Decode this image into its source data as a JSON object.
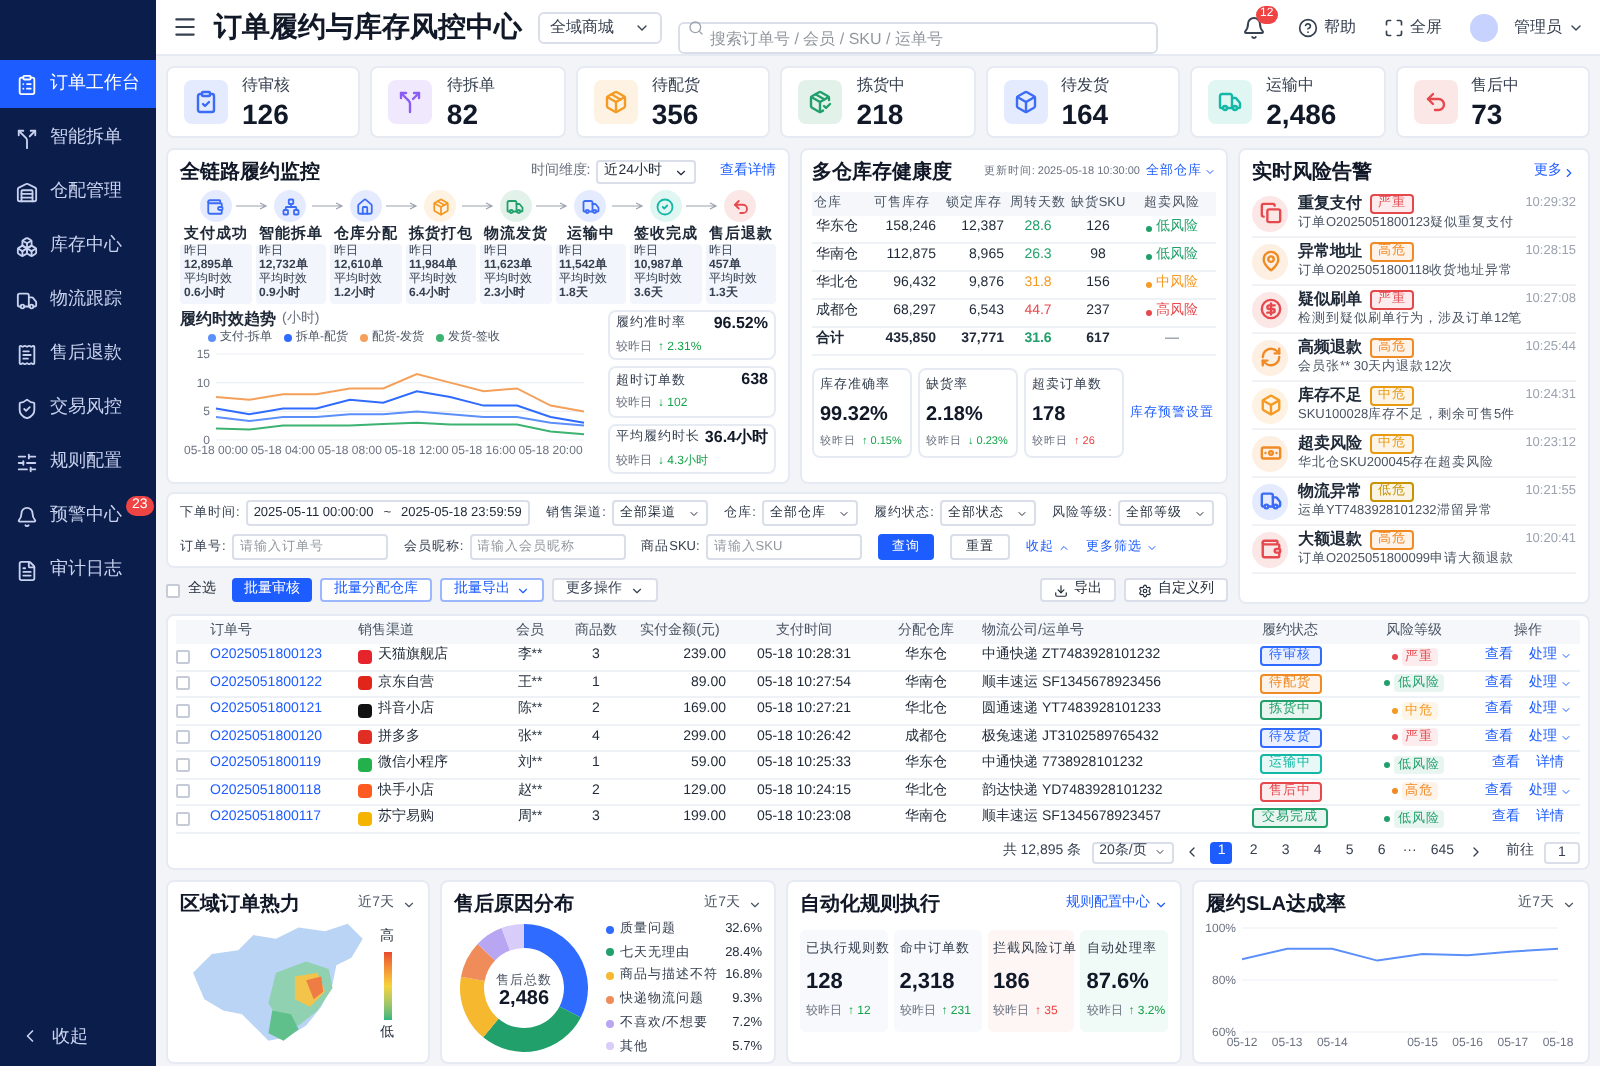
{
  "sidebar": {
    "items": [
      {
        "label": "订单工作台",
        "selected": true
      },
      {
        "label": "智能拆单",
        "selected": false
      },
      {
        "label": "仓配管理",
        "selected": false
      },
      {
        "label": "库存中心",
        "selected": false
      },
      {
        "label": "物流跟踪",
        "selected": false
      },
      {
        "label": "售后退款",
        "selected": false
      },
      {
        "label": "交易风控",
        "selected": false
      },
      {
        "label": "规则配置",
        "selected": false
      },
      {
        "label": "预警中心",
        "selected": false,
        "badge": "23"
      },
      {
        "label": "审计日志",
        "selected": false
      }
    ],
    "collapse": "收起"
  },
  "header": {
    "title": "订单履约与库存风控中心",
    "store": "全域商城",
    "search_placeholder": "搜索订单号 / 会员 / SKU / 运单号",
    "notifications": "12",
    "help": "帮助",
    "fullscreen": "全屏",
    "user": "管理员"
  },
  "kpis": [
    {
      "label": "待审核",
      "value": "126",
      "color": "#3b6cf6"
    },
    {
      "label": "待拆单",
      "value": "82",
      "color": "#8b5cf6"
    },
    {
      "label": "待配货",
      "value": "356",
      "color": "#f59a23"
    },
    {
      "label": "拣货中",
      "value": "218",
      "color": "#22a06b"
    },
    {
      "label": "待发货",
      "value": "164",
      "color": "#3b6cf6"
    },
    {
      "label": "运输中",
      "value": "2,486",
      "color": "#14b8a6"
    },
    {
      "label": "售后中",
      "value": "73",
      "color": "#e5484d"
    }
  ],
  "pipeline": {
    "title": "全链路履约监控",
    "range_label": "时间维度:",
    "range": "近24小时",
    "link": "查看详情",
    "stages": [
      {
        "name": "支付成功",
        "color": "#3b6cf6",
        "yesterday_label": "昨日",
        "yesterday": "12,895单",
        "avg_label": "平均时效",
        "avg": "0.6小时"
      },
      {
        "name": "智能拆单",
        "color": "#3b6cf6",
        "yesterday_label": "昨日",
        "yesterday": "12,732单",
        "avg_label": "平均时效",
        "avg": "0.9小时"
      },
      {
        "name": "仓库分配",
        "color": "#3b6cf6",
        "yesterday_label": "昨日",
        "yesterday": "12,610单",
        "avg_label": "平均时效",
        "avg": "1.2小时"
      },
      {
        "name": "拣货打包",
        "color": "#f59a23",
        "yesterday_label": "昨日",
        "yesterday": "11,984单",
        "avg_label": "平均时效",
        "avg": "6.4小时"
      },
      {
        "name": "物流发货",
        "color": "#22a06b",
        "yesterday_label": "昨日",
        "yesterday": "11,623单",
        "avg_label": "平均时效",
        "avg": "2.3小时"
      },
      {
        "name": "运输中",
        "color": "#3b6cf6",
        "yesterday_label": "昨日",
        "yesterday": "11,542单",
        "avg_label": "平均时效",
        "avg": "1.8天"
      },
      {
        "name": "签收完成",
        "color": "#14b8a6",
        "yesterday_label": "昨日",
        "yesterday": "10,987单",
        "avg_label": "平均时效",
        "avg": "3.6天"
      },
      {
        "name": "售后退款",
        "color": "#e5484d",
        "yesterday_label": "昨日",
        "yesterday": "457单",
        "avg_label": "平均时效",
        "avg": "1.3天"
      }
    ],
    "chart_data": {
      "type": "line",
      "title": "履约时效趋势",
      "ylabel": "(小时)",
      "categories": [
        "05-18 00:00",
        null,
        "05-18 04:00",
        null,
        "05-18 08:00",
        null,
        "05-18 12:00",
        null,
        "05-18 16:00",
        null,
        "05-18 20:00",
        null
      ],
      "ylim": [
        0,
        15
      ],
      "yticks": [
        {
          "value": 0,
          "label": "0"
        },
        {
          "value": 5,
          "label": "5"
        },
        {
          "value": 10,
          "label": "10"
        },
        {
          "value": 15,
          "label": "15"
        }
      ],
      "series": [
        {
          "name": "支付-拆单",
          "color": "#5b8ff9",
          "values": [
            4,
            3.3,
            4,
            4,
            4.5,
            4.5,
            5,
            4.5,
            4,
            4,
            3,
            2.5
          ]
        },
        {
          "name": "拆单-配货",
          "color": "#2f6bff",
          "values": [
            5.5,
            4.5,
            5.5,
            5.5,
            7,
            6.5,
            8.5,
            7.5,
            6,
            6,
            4,
            3
          ]
        },
        {
          "name": "配货-发货",
          "color": "#f5a05a",
          "values": [
            7.5,
            7,
            8,
            8,
            9,
            9,
            11.5,
            10,
            8.5,
            9,
            6,
            5
          ]
        },
        {
          "name": "发货-签收",
          "color": "#3cb371",
          "values": [
            2,
            1.8,
            2.5,
            2.5,
            2.5,
            2.8,
            3,
            2.7,
            2.7,
            2.7,
            1.5,
            1
          ]
        }
      ]
    },
    "stats": [
      {
        "label": "履约准时率",
        "value": "96.52%",
        "compare": "较昨日",
        "change": "↑ 2.31%",
        "good": true
      },
      {
        "label": "超时订单数",
        "value": "638",
        "compare": "较昨日",
        "change": "↓ 102",
        "good": true
      },
      {
        "label": "平均履约时长",
        "value": "36.4小时",
        "compare": "较昨日",
        "change": "↓ 4.3小时",
        "good": true
      }
    ]
  },
  "inventory": {
    "title": "多仓库存健康度",
    "updated": "更新时间: 2025-05-18 10:30:00",
    "scope": "全部仓库",
    "columns": [
      "仓库",
      "可售库存",
      "锁定库存",
      "周转天数",
      "缺货SKU",
      "超卖风险"
    ],
    "rows": [
      {
        "warehouse": "华东仓",
        "sellable": "158,246",
        "locked": "12,387",
        "turnover": {
          "text": "28.6",
          "color": "#22a06b"
        },
        "short": "126",
        "risk": {
          "text": "低风险",
          "color": "#22a06b"
        }
      },
      {
        "warehouse": "华南仓",
        "sellable": "112,875",
        "locked": "8,965",
        "turnover": {
          "text": "26.3",
          "color": "#22a06b"
        },
        "short": "98",
        "risk": {
          "text": "低风险",
          "color": "#22a06b"
        }
      },
      {
        "warehouse": "华北仓",
        "sellable": "96,432",
        "locked": "9,876",
        "turnover": {
          "text": "31.8",
          "color": "#f59a23"
        },
        "short": "156",
        "risk": {
          "text": "中风险",
          "color": "#f59a23"
        }
      },
      {
        "warehouse": "成都仓",
        "sellable": "68,297",
        "locked": "6,543",
        "turnover": {
          "text": "44.7",
          "color": "#e5484d"
        },
        "short": "237",
        "risk": {
          "text": "高风险",
          "color": "#e5484d"
        }
      }
    ],
    "total": {
      "warehouse": "合计",
      "sellable": "435,850",
      "locked": "37,771",
      "turnover": {
        "text": "31.6",
        "color": "#22a06b"
      },
      "short": "617",
      "risk": {
        "text": "—"
      }
    },
    "stats": [
      {
        "label": "库存准确率",
        "value": "99.32%",
        "compare": "较昨日",
        "change": "↑ 0.15%",
        "good": true
      },
      {
        "label": "缺货率",
        "value": "2.18%",
        "compare": "较昨日",
        "change": "↓ 0.23%",
        "good": true
      },
      {
        "label": "超卖订单数",
        "value": "178",
        "compare": "较昨日",
        "change": "↑ 26",
        "good": false
      }
    ],
    "link": "库存预警设置"
  },
  "alerts": {
    "title": "实时风险告警",
    "more": "更多",
    "items": [
      {
        "title": "重复支付",
        "tag": {
          "text": "严重",
          "color": "#e5484d"
        },
        "text": "订单O2025051800123疑似重复支付",
        "time": "10:29:32",
        "color": "#e5484d"
      },
      {
        "title": "异常地址",
        "tag": {
          "text": "高危",
          "color": "#f08a24"
        },
        "text": "订单O2025051800118收货地址异常",
        "time": "10:28:15",
        "color": "#f08a24"
      },
      {
        "title": "疑似刷单",
        "tag": {
          "text": "严重",
          "color": "#e5484d"
        },
        "text": "检测到疑似刷单行为，涉及订单12笔",
        "time": "10:27:08",
        "color": "#e5484d"
      },
      {
        "title": "高频退款",
        "tag": {
          "text": "高危",
          "color": "#f08a24"
        },
        "text": "会员张** 30天内退款12次",
        "time": "10:25:44",
        "color": "#f08a24"
      },
      {
        "title": "库存不足",
        "tag": {
          "text": "中危",
          "color": "#e89a10"
        },
        "text": "SKU100028库存不足，剩余可售5件",
        "time": "10:24:31",
        "color": "#f59a23"
      },
      {
        "title": "超卖风险",
        "tag": {
          "text": "中危",
          "color": "#e89a10"
        },
        "text": "华北仓SKU200045存在超卖风险",
        "time": "10:23:12",
        "color": "#f08a24"
      },
      {
        "title": "物流异常",
        "tag": {
          "text": "低危",
          "color": "#c99400"
        },
        "text": "运单YT7483928101232滞留异常",
        "time": "10:21:55",
        "color": "#3b6cf6"
      },
      {
        "title": "大额退款",
        "tag": {
          "text": "高危",
          "color": "#f08a24"
        },
        "text": "订单O2025051800099申请大额退款",
        "time": "10:20:41",
        "color": "#e5484d"
      }
    ]
  },
  "filters": [
    {
      "kind": "daterange",
      "label": "下单时间:",
      "start": "2025-05-11 00:00:00",
      "separator": "~",
      "end": "2025-05-18 23:59:59"
    },
    {
      "kind": "select",
      "label": "销售渠道:",
      "value": "全部渠道"
    },
    {
      "kind": "select",
      "label": "仓库:",
      "value": "全部仓库"
    },
    {
      "kind": "select",
      "label": "履约状态:",
      "value": "全部状态"
    },
    {
      "kind": "select",
      "label": "风险等级:",
      "value": "全部等级"
    },
    {
      "kind": "input",
      "label": "订单号:",
      "placeholder": "请输入订单号"
    },
    {
      "kind": "input",
      "label": "会员昵称:",
      "placeholder": "请输入会员昵称"
    },
    {
      "kind": "input",
      "label": "商品SKU:",
      "placeholder": "请输入SKU"
    }
  ],
  "filter_buttons": [
    {
      "label": "查询",
      "kind": "primary"
    },
    {
      "label": "重置",
      "kind": "default"
    },
    {
      "label": "收起",
      "kind": "collapse"
    },
    {
      "label": "更多筛选",
      "kind": "expand"
    }
  ],
  "bulk": {
    "select_all": {
      "label": "全选",
      "checked": false
    },
    "buttons": [
      {
        "label": "批量审核",
        "kind": "primary"
      },
      {
        "label": "批量分配仓库",
        "kind": "outline"
      },
      {
        "label": "批量导出",
        "kind": "outline-menu"
      },
      {
        "label": "更多操作",
        "kind": "menu"
      }
    ],
    "tools": [
      {
        "label": "导出",
        "kind": "download"
      },
      {
        "label": "自定义列",
        "kind": "settings"
      }
    ]
  },
  "orders": {
    "columns": [
      "订单号",
      "销售渠道",
      "会员",
      "商品数",
      "实付金额(元)",
      "支付时间",
      "分配仓库",
      "物流公司/运单号",
      "履约状态",
      "风险等级",
      "操作"
    ],
    "rows": [
      {
        "checked": false,
        "id": "O2025051800123",
        "channel": {
          "text": "天猫旗舰店",
          "color": "#e5242b"
        },
        "member": "李**",
        "qty": "3",
        "amount": "239.00",
        "paid": "05-18 10:28:31",
        "warehouse": "华东仓",
        "carrier": "中通快递",
        "waybill": "ZT7483928101232",
        "status": {
          "text": "待审核",
          "color": "#2f6bff"
        },
        "risk": {
          "text": "严重",
          "color": "#e5484d"
        },
        "actions": [
          {
            "label": "查看",
            "menu": false
          },
          {
            "label": "处理",
            "menu": true
          }
        ]
      },
      {
        "checked": false,
        "id": "O2025051800122",
        "channel": {
          "text": "京东自营",
          "color": "#e1251b"
        },
        "member": "王**",
        "qty": "1",
        "amount": "89.00",
        "paid": "05-18 10:27:54",
        "warehouse": "华南仓",
        "carrier": "顺丰速运",
        "waybill": "SF1345678923456",
        "status": {
          "text": "待配货",
          "color": "#f08a24"
        },
        "risk": {
          "text": "低风险",
          "color": "#22a06b"
        },
        "actions": [
          {
            "label": "查看",
            "menu": false
          },
          {
            "label": "处理",
            "menu": true
          }
        ]
      },
      {
        "checked": false,
        "id": "O2025051800121",
        "channel": {
          "text": "抖音小店",
          "color": "#111111"
        },
        "member": "陈**",
        "qty": "2",
        "amount": "169.00",
        "paid": "05-18 10:27:21",
        "warehouse": "华北仓",
        "carrier": "圆通速递",
        "waybill": "YT7483928101233",
        "status": {
          "text": "拣货中",
          "color": "#22a06b"
        },
        "risk": {
          "text": "中危",
          "color": "#f59a23"
        },
        "actions": [
          {
            "label": "查看",
            "menu": false
          },
          {
            "label": "处理",
            "menu": true
          }
        ]
      },
      {
        "checked": false,
        "id": "O2025051800120",
        "channel": {
          "text": "拼多多",
          "color": "#e02e24"
        },
        "member": "张**",
        "qty": "4",
        "amount": "299.00",
        "paid": "05-18 10:26:42",
        "warehouse": "成都仓",
        "carrier": "极兔速递",
        "waybill": "JT3102589765432",
        "status": {
          "text": "待发货",
          "color": "#2f6bff"
        },
        "risk": {
          "text": "严重",
          "color": "#e5484d"
        },
        "actions": [
          {
            "label": "查看",
            "menu": false
          },
          {
            "label": "处理",
            "menu": true
          }
        ]
      },
      {
        "checked": false,
        "id": "O2025051800119",
        "channel": {
          "text": "微信小程序",
          "color": "#22b14c"
        },
        "member": "刘**",
        "qty": "1",
        "amount": "59.00",
        "paid": "05-18 10:25:33",
        "warehouse": "华东仓",
        "carrier": "中通快递",
        "waybill": "7738928101232",
        "status": {
          "text": "运输中",
          "color": "#14b8a6"
        },
        "risk": {
          "text": "低风险",
          "color": "#22a06b"
        },
        "actions": [
          {
            "label": "查看",
            "menu": false
          },
          {
            "label": "详情",
            "menu": false
          }
        ]
      },
      {
        "checked": false,
        "id": "O2025051800118",
        "channel": {
          "text": "快手小店",
          "color": "#ff5a1f"
        },
        "member": "赵**",
        "qty": "2",
        "amount": "129.00",
        "paid": "05-18 10:24:15",
        "warehouse": "华北仓",
        "carrier": "韵达快递",
        "waybill": "YD7483928101232",
        "status": {
          "text": "售后中",
          "color": "#e5484d"
        },
        "risk": {
          "text": "高危",
          "color": "#f08a24"
        },
        "actions": [
          {
            "label": "查看",
            "menu": false
          },
          {
            "label": "处理",
            "menu": true
          }
        ]
      },
      {
        "checked": false,
        "id": "O2025051800117",
        "channel": {
          "text": "苏宁易购",
          "color": "#f5b400"
        },
        "member": "周**",
        "qty": "3",
        "amount": "199.00",
        "paid": "05-18 10:23:08",
        "warehouse": "华南仓",
        "carrier": "顺丰速运",
        "waybill": "SF1345678923457",
        "status": {
          "text": "交易完成",
          "color": "#22a06b"
        },
        "risk": {
          "text": "低风险",
          "color": "#22a06b"
        },
        "actions": [
          {
            "label": "查看",
            "menu": false
          },
          {
            "label": "详情",
            "menu": false
          }
        ]
      }
    ]
  },
  "pagination": {
    "total": "共 12,895 条",
    "page_size": "20条/页",
    "pages": [
      {
        "kind": "page",
        "label": "1",
        "selected": true
      },
      {
        "kind": "page",
        "label": "2",
        "selected": false
      },
      {
        "kind": "page",
        "label": "3",
        "selected": false
      },
      {
        "kind": "page",
        "label": "4",
        "selected": false
      },
      {
        "kind": "page",
        "label": "5",
        "selected": false
      },
      {
        "kind": "page",
        "label": "6",
        "selected": false
      },
      {
        "kind": "ellipsis",
        "label": "···",
        "selected": false
      },
      {
        "kind": "page",
        "label": "645",
        "selected": false
      }
    ],
    "goto_label": "前往",
    "goto_value": "1"
  },
  "heatmap": {
    "title": "区域订单热力",
    "range": "近7天",
    "legend_high": "高",
    "legend_low": "低"
  },
  "aftersales": {
    "range": "近7天",
    "center_label": "售后总数",
    "center_value": "2,486",
    "chart_data": {
      "type": "donut",
      "title": "售后原因分布",
      "categories": [
        "质量问题",
        "七天无理由",
        "商品与描述不符",
        "快递物流问题",
        "不喜欢/不想要",
        "其他"
      ],
      "values": [
        32.6,
        28.4,
        16.8,
        9.3,
        7.2,
        5.7
      ],
      "colors": [
        "#2f6bff",
        "#22a06b",
        "#f5b82e",
        "#f08c5a",
        "#b9a6f2",
        "#d8ccfa"
      ],
      "value_labels": [
        "32.6%",
        "28.4%",
        "16.8%",
        "9.3%",
        "7.2%",
        "5.7%"
      ]
    }
  },
  "automation": {
    "title": "自动化规则执行",
    "link": "规则配置中心",
    "stats": [
      {
        "label": "已执行规则数",
        "value": "128",
        "compare": "较昨日",
        "change": "↑ 12",
        "good": true
      },
      {
        "label": "命中订单数",
        "value": "2,318",
        "compare": "较昨日",
        "change": "↑ 231",
        "good": true
      },
      {
        "label": "拦截风险订单",
        "value": "186",
        "compare": "较昨日",
        "change": "↑ 35",
        "good": false
      },
      {
        "label": "自动处理率",
        "value": "87.6%",
        "compare": "较昨日",
        "change": "↑ 3.2%",
        "good": true
      }
    ]
  },
  "sla": {
    "range": "近7天",
    "chart_data": {
      "type": "line",
      "title": "履约SLA达成率",
      "categories": [
        "05-12",
        "05-13",
        "05-14",
        null,
        "05-15",
        "05-16",
        "05-17",
        "05-18"
      ],
      "ylim": [
        60,
        100
      ],
      "yticks": [
        {
          "value": 60,
          "label": "60%"
        },
        {
          "value": 80,
          "label": "80%"
        },
        {
          "value": 100,
          "label": "100%"
        }
      ],
      "series": [
        {
          "color": "#5b8ff9",
          "values": [
            88,
            92,
            92,
            87.5,
            90,
            89.5,
            91,
            92
          ]
        }
      ]
    }
  }
}
